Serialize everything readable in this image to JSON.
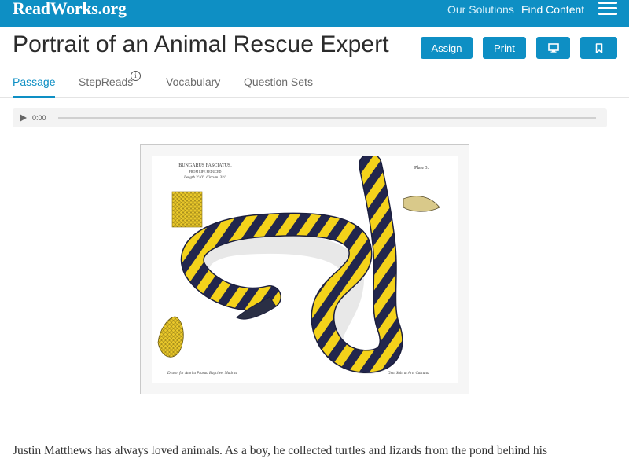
{
  "brand": {
    "logo": "ReadWorks.org",
    "color": "#0e8fc4"
  },
  "nav": {
    "solutions": "Our Solutions",
    "find_content": "Find Content"
  },
  "page": {
    "title": "Portrait of an Animal Rescue Expert"
  },
  "actions": {
    "assign": "Assign",
    "print": "Print",
    "present_icon": "monitor-icon",
    "bookmark_icon": "bookmark-icon"
  },
  "tabs": [
    {
      "label": "Passage",
      "active": true
    },
    {
      "label": "StepReads",
      "info_icon": "info-icon"
    },
    {
      "label": "Vocabulary"
    },
    {
      "label": "Question Sets"
    }
  ],
  "audio": {
    "time": "0:00",
    "progress": 0
  },
  "figure": {
    "plate_title": "BUNGARUS FASCIATUS.",
    "plate_subtitle": "FROM LIFE REDUCED",
    "plate_scale": "Length 3'10\". Circum. 3½\"",
    "plate_number": "Plate 3.",
    "credit_left": "Drawn for Amrita Prasad Bagchee, Madras.",
    "credit_right": "Geo. Sub. at Arts Calcutta"
  },
  "passage": {
    "first_line": "Justin Matthews has always loved animals. As a boy, he collected turtles and lizards from the pond behind his"
  }
}
